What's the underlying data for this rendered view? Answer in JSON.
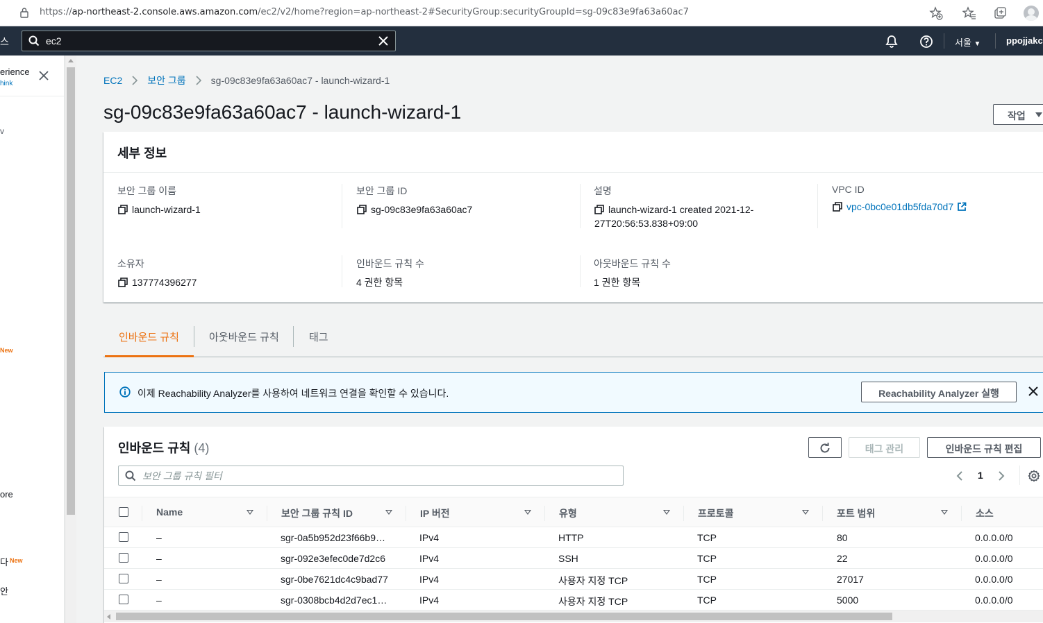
{
  "browser": {
    "url_prefix": "https://",
    "url_host": "ap-northeast-2.console.aws.amazon.com",
    "url_path": "/ec2/v2/home?region=ap-northeast-2#SecurityGroup:securityGroupId=sg-09c83e9fa63a60ac7"
  },
  "topnav": {
    "left_cut": "스",
    "search_value": "ec2",
    "region": "서울",
    "username": "ppojjakco"
  },
  "sidebar": {
    "experience": "erience",
    "think": "hink",
    "v_text": "v",
    "new1": "New",
    "ore": "ore",
    "ta": "다",
    "new2": "New",
    "an": "안"
  },
  "breadcrumb": {
    "ec2": "EC2",
    "security_groups": "보안 그룹",
    "current": "sg-09c83e9fa63a60ac7 - launch-wizard-1"
  },
  "page": {
    "title": "sg-09c83e9fa63a60ac7 - launch-wizard-1",
    "actions_label": "작업"
  },
  "details": {
    "header": "세부 정보",
    "sg_name_label": "보안 그룹 이름",
    "sg_name_value": "launch-wizard-1",
    "sg_id_label": "보안 그룹 ID",
    "sg_id_value": "sg-09c83e9fa63a60ac7",
    "desc_label": "설명",
    "desc_value": "launch-wizard-1 created 2021-12-27T20:56:53.838+09:00",
    "vpc_label": "VPC ID",
    "vpc_value": "vpc-0bc0e01db5fda70d7",
    "owner_label": "소유자",
    "owner_value": "137774396277",
    "inbound_count_label": "인바운드 규칙 수",
    "inbound_count_value": "4 권한 항목",
    "outbound_count_label": "아웃바운드 규칙 수",
    "outbound_count_value": "1 권한 항목"
  },
  "tabs": [
    "인바운드 규칙",
    "아웃바운드 규칙",
    "태그"
  ],
  "banner": {
    "message": "이제 Reachability Analyzer를 사용하여 네트워크 연결을 확인할 수 있습니다.",
    "button": "Reachability Analyzer 실행"
  },
  "rules": {
    "title": "인바운드 규칙",
    "count": "(4)",
    "tag_button": "태그 관리",
    "edit_button": "인바운드 규칙 편집",
    "filter_placeholder": "보안 그룹 규칙 필터",
    "page": "1",
    "columns": [
      "Name",
      "보안 그룹 규칙 ID",
      "IP 버전",
      "유형",
      "프로토콜",
      "포트 범위",
      "소스"
    ],
    "rows": [
      {
        "name": "–",
        "id": "sgr-0a5b952d23f66b9…",
        "ip": "IPv4",
        "type": "HTTP",
        "protocol": "TCP",
        "port": "80",
        "source": "0.0.0.0/0"
      },
      {
        "name": "–",
        "id": "sgr-092e3efec0de7d2c6",
        "ip": "IPv4",
        "type": "SSH",
        "protocol": "TCP",
        "port": "22",
        "source": "0.0.0.0/0"
      },
      {
        "name": "–",
        "id": "sgr-0be7621dc4c9bad77",
        "ip": "IPv4",
        "type": "사용자 지정 TCP",
        "protocol": "TCP",
        "port": "27017",
        "source": "0.0.0.0/0"
      },
      {
        "name": "–",
        "id": "sgr-0308bcb4d2d7ec1…",
        "ip": "IPv4",
        "type": "사용자 지정 TCP",
        "protocol": "TCP",
        "port": "5000",
        "source": "0.0.0.0/0"
      }
    ]
  },
  "colors": {
    "aws_nav": "#232f3e",
    "link": "#0073bb",
    "accent_orange": "#ec7211"
  }
}
